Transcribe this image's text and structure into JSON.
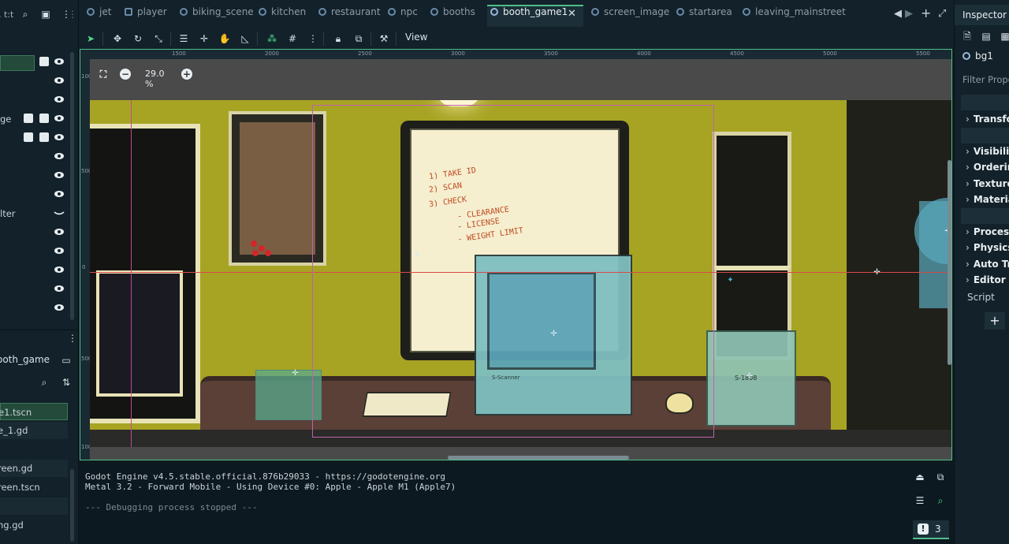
{
  "left_dock": {
    "search_label": ", t:t",
    "tree_items": [
      {
        "label": ""
      },
      {
        "label": ""
      },
      {
        "label": ""
      },
      {
        "label": "ge"
      },
      {
        "label": ""
      },
      {
        "label": ""
      },
      {
        "label": ""
      },
      {
        "label": ""
      },
      {
        "label": "lter"
      },
      {
        "label": ""
      },
      {
        "label": ""
      },
      {
        "label": ""
      },
      {
        "label": ""
      },
      {
        "label": ""
      }
    ],
    "filesystem": {
      "header": "ooth_game",
      "files": [
        "e1.tscn",
        "e_1.gd",
        "",
        "reen.gd",
        "reen.tscn",
        "",
        "ng.gd"
      ]
    }
  },
  "tabs": [
    {
      "label": "jet"
    },
    {
      "label": "player"
    },
    {
      "label": "biking_scene"
    },
    {
      "label": "kitchen"
    },
    {
      "label": "restaurant"
    },
    {
      "label": "npc"
    },
    {
      "label": "booths"
    },
    {
      "label": "booth_game1",
      "active": true
    },
    {
      "label": "screen_image"
    },
    {
      "label": "startarea"
    },
    {
      "label": "leaving_mainstreet"
    }
  ],
  "toolbar": {
    "view_label": "View",
    "tools": [
      "select-icon",
      "move-icon",
      "rotate-icon",
      "scale-icon",
      "list-select-icon",
      "pivot-icon",
      "pan-icon",
      "ruler-icon",
      "smart-snap-icon",
      "grid-snap-icon",
      "more-icon",
      "lock-icon",
      "group-icon",
      "bone-icon"
    ]
  },
  "viewport": {
    "zoom_label": "29.0 %",
    "ruler_top": [
      "1500",
      "2000",
      "2500",
      "3000",
      "3500",
      "4000",
      "4500",
      "5000",
      "5500"
    ],
    "ruler_left": [
      "1000",
      "500",
      "0",
      "500",
      "1000"
    ],
    "whiteboard_lines": [
      "1) TAKE ID",
      "2) SCAN",
      "3) CHECK",
      "- CLEARANCE",
      "- LICENSE",
      "- WEIGHT LIMIT"
    ],
    "scanner_label": "S-1808",
    "monitor_brand": "S-Scanner"
  },
  "inspector": {
    "title": "Inspector",
    "node_name": "bg1",
    "filter_placeholder": "Filter Prope",
    "sections": [
      "Transfor",
      "Visibility",
      "Ordering",
      "Texture",
      "Material",
      "Process",
      "Physics I",
      "Auto Tra",
      "Editor De"
    ],
    "script_label": "Script"
  },
  "output": {
    "lines": [
      "Godot Engine v4.5.stable.official.876b29033 - https://godotengine.org",
      "Metal 3.2 - Forward Mobile - Using Device #0: Apple - Apple M1 (Apple7)",
      "--- Debugging process stopped ---"
    ],
    "error_count": "3"
  },
  "colors": {
    "accent": "#4fbf8a",
    "panel_bg": "#12212a",
    "wall": "#a7a424"
  }
}
